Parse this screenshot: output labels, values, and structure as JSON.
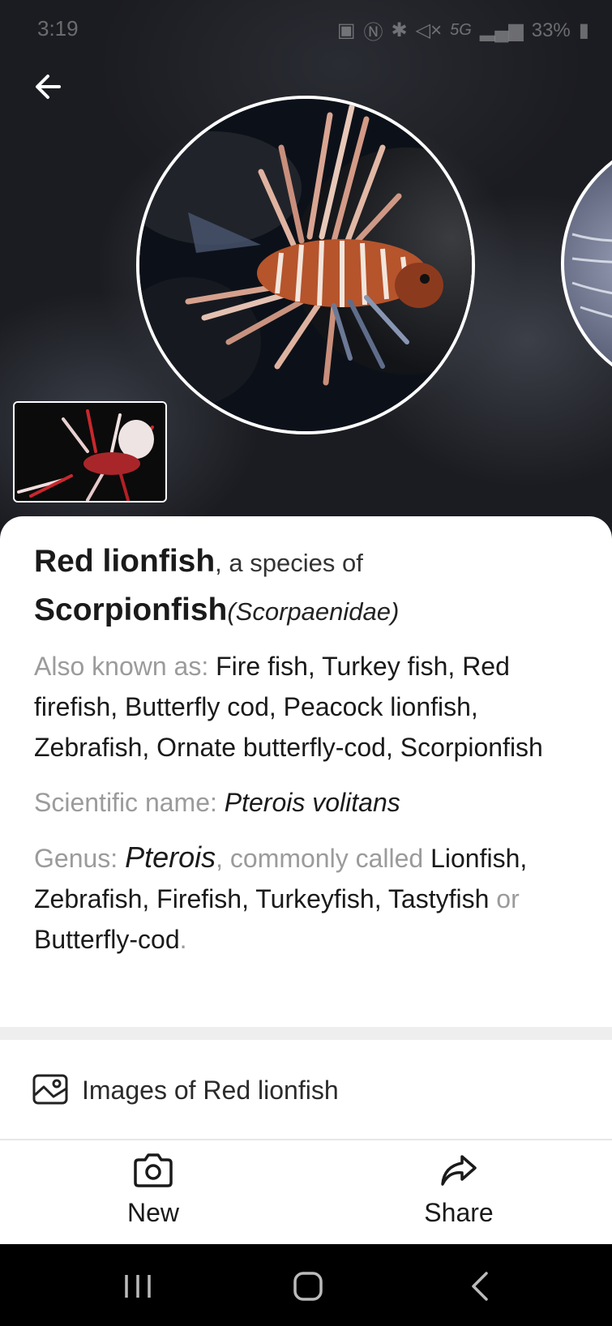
{
  "status_bar": {
    "time": "3:19",
    "network": "5G",
    "battery": "33%"
  },
  "species": {
    "common_name": "Red lionfish",
    "species_of_text": ", a species of",
    "family_common": "Scorpionfish",
    "family_scientific": "(Scorpaenidae)"
  },
  "also_known_as": {
    "label": "Also known as: ",
    "value": "Fire fish, Turkey fish, Red firefish, Butterfly cod, Peacock lionfish, Zebrafish, Ornate butterfly-cod, Scorpionfish"
  },
  "scientific_name": {
    "label": "Scientific name: ",
    "value": "Pterois volitans"
  },
  "genus": {
    "label": "Genus: ",
    "name": "Pterois",
    "commonly_called_text": ", commonly called",
    "common_names": "Lionfish, Zebrafish, Firefish, Turkeyfish, Tastyfish",
    "or_text": " or ",
    "last_name": "Butterfly-cod",
    "period": "."
  },
  "images_row": {
    "label": "Images of Red lionfish",
    "icon": "image-gallery-icon"
  },
  "actions": {
    "new_label": "New",
    "new_icon": "camera-icon",
    "share_label": "Share",
    "share_icon": "share-icon"
  },
  "navigation": {
    "back_icon": "arrow-left-icon",
    "recents_icon": "recents-icon",
    "home_icon": "home-icon",
    "system_back_icon": "chevron-left-icon"
  },
  "colors": {
    "sheet_bg": "#ffffff",
    "muted_text": "#9b9b9b",
    "primary_text": "#1a1a1a",
    "hero_bg": "#1b1c21"
  }
}
